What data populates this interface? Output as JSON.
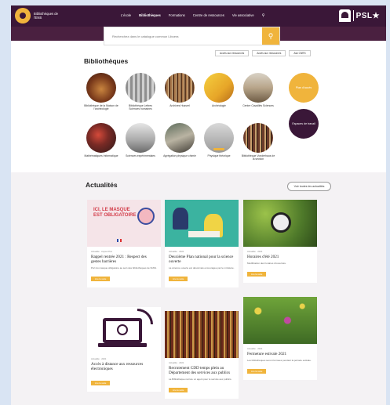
{
  "header": {
    "logo_text": "Bibliothèques de l'ENS",
    "nav": [
      "L'école",
      "Bibliothèques",
      "Formations",
      "Centre de ressources",
      "Vie associative"
    ],
    "brand": "PSL★"
  },
  "search": {
    "placeholder": "Recherchez dans le catalogue commun Libcera"
  },
  "quick_links": [
    "Accès aux ressources",
    "Accès aux ressources",
    "Ask CNRS"
  ],
  "libraries": {
    "title": "Bibliothèques",
    "items": [
      "Bibliothèque de la Maison de l'archéologie",
      "Bibliothèque Lettres Sciences humaines",
      "Archives Husserl",
      "Archéologie",
      "Centre Cavaillès Sciences",
      "Mathématiques Informatique",
      "Sciences expérimentales",
      "Agrégation physique chimie",
      "Physique théorique",
      "Bibliothèque Vonderhaus de la section"
    ],
    "cta_primary": "Plan d'accès",
    "cta_secondary": "Espaces de travail"
  },
  "news": {
    "title": "Actualités",
    "more_label": "Voir toutes les actualités",
    "poster_line1": "ICI, LE MASQUE",
    "poster_line2": "EST OBLIGATOIRE",
    "cards": [
      {
        "date": "Actualité · Aujourd'hui",
        "title": "Rappel rentrée 2021 : Respect des gestes barrières",
        "text": "Port du masque obligatoire au sein des bibliothèques de l'ENS.",
        "button": "Lire la suite"
      },
      {
        "date": "Actualité · 2021",
        "title": "Deuxième Plan national pour la science ouverte",
        "text": "La science ouverte est désormais encouragée par le ministère.",
        "button": "Lire la suite"
      },
      {
        "date": "Actualité · 2021",
        "title": "Horaires d'été 2021",
        "text": "Modification des horaires d'ouverture.",
        "button": "Lire la suite"
      },
      {
        "date": "Actualité · 2021",
        "title": "Accès à distance aux ressources électroniques",
        "text": "",
        "button": "Lire la suite"
      },
      {
        "date": "Actualité · 2021",
        "title": "Recrutement CDD temps plein au Département des services aux publics",
        "text": "La Bibliothèque recrute un agent pour le service aux publics.",
        "button": "Lire la suite"
      },
      {
        "date": "Actualité · 2021",
        "title": "Fermeture estivale 2021",
        "text": "Les bibliothèques seront fermées pendant la période estivale.",
        "button": "Lire la suite"
      }
    ]
  },
  "colors": {
    "primary": "#3a1738",
    "accent": "#f0b43c"
  }
}
